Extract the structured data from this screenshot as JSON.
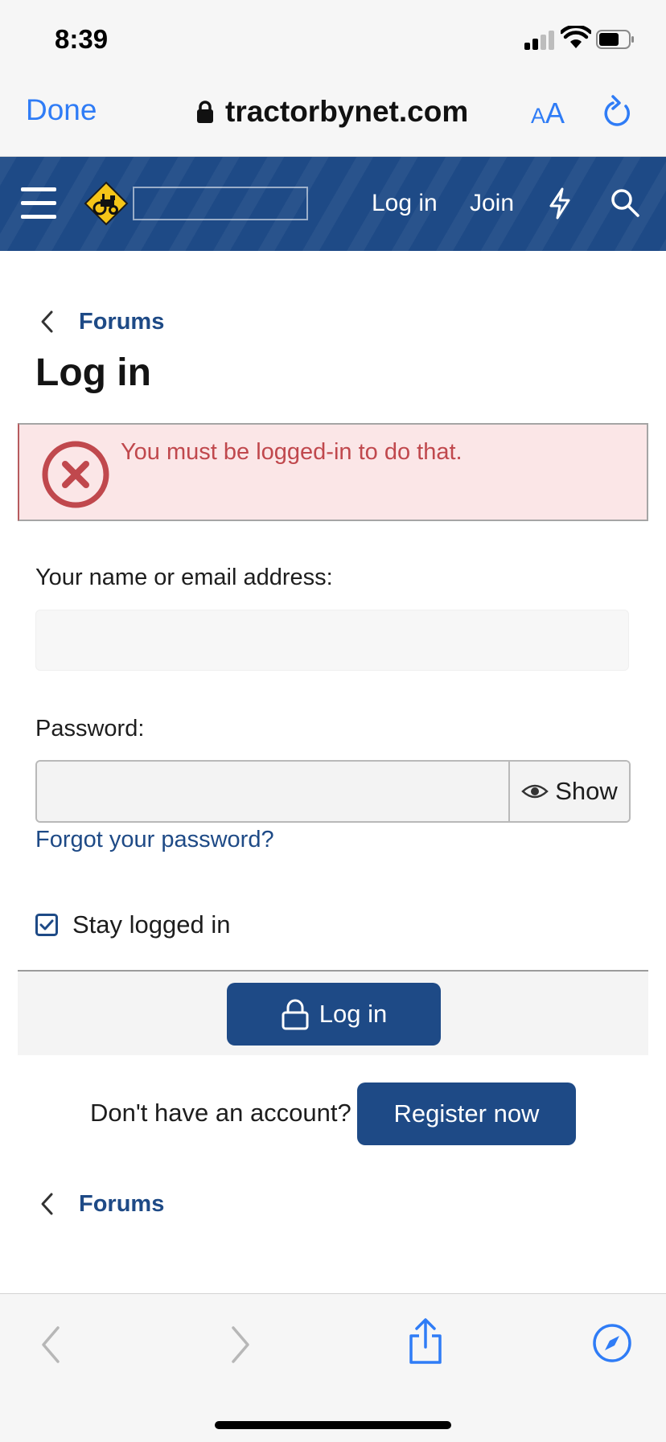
{
  "status_bar": {
    "time": "8:39"
  },
  "safari": {
    "done_label": "Done",
    "url": "tractorbynet.com",
    "aa_small": "A",
    "aa_large": "A"
  },
  "nav": {
    "login_label": "Log in",
    "join_label": "Join",
    "icons": [
      "menu-icon",
      "tractor-logo",
      "bolt-icon",
      "search-icon"
    ]
  },
  "breadcrumb": {
    "label": "Forums"
  },
  "page": {
    "title": "Log in"
  },
  "error": {
    "message": "You must be logged-in to do that."
  },
  "form": {
    "name_label": "Your name or email address:",
    "name_value": "",
    "password_label": "Password:",
    "password_value": "",
    "show_label": "Show",
    "forgot_label": "Forgot your password?",
    "stay_logged_in_label": "Stay logged in",
    "stay_logged_in_checked": true,
    "submit_label": "Log in"
  },
  "register": {
    "prompt": "Don't have an account?",
    "button_label": "Register now"
  },
  "footer_breadcrumb": {
    "label": "Forums"
  },
  "colors": {
    "brand_blue": "#1e4a86",
    "ios_blue": "#2f7cf6",
    "error_text": "#c0484d",
    "error_bg": "#fbe6e7"
  }
}
